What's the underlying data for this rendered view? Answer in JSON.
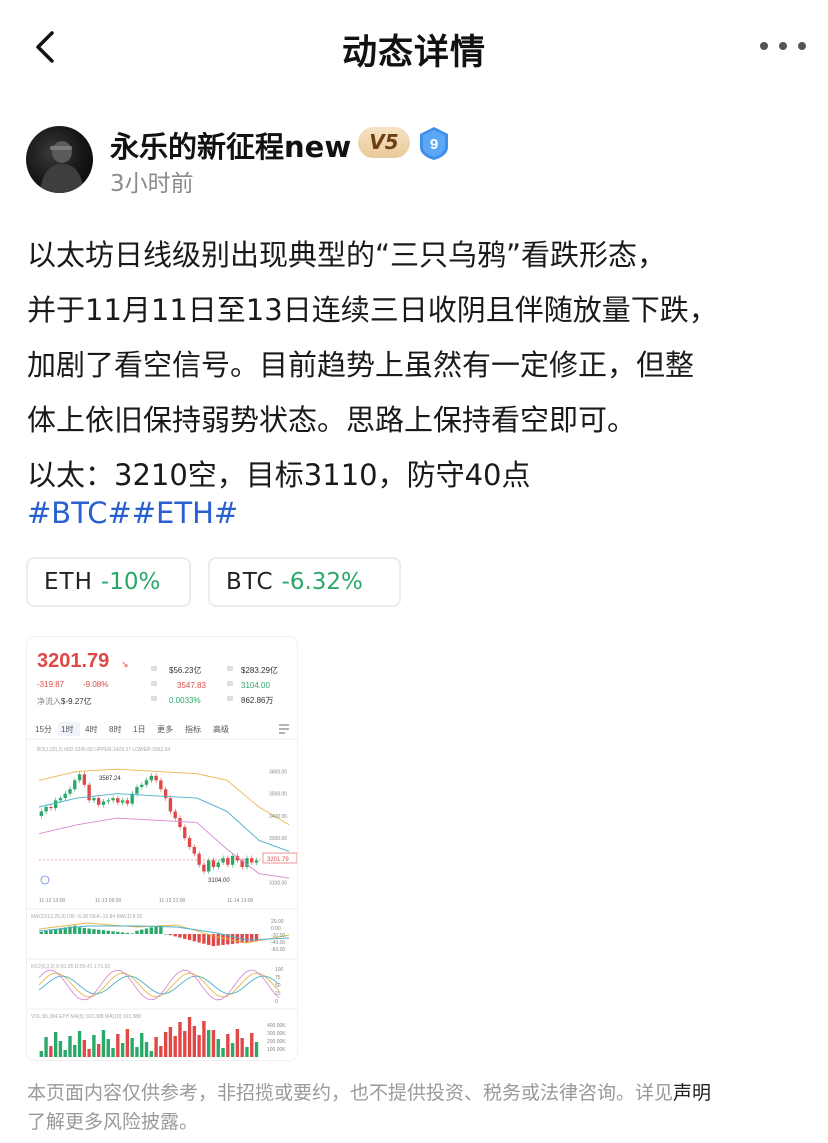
{
  "nav": {
    "title": "动态详情",
    "back_icon": "chevron-left-icon",
    "more_icon": "more-horizontal-icon"
  },
  "author": {
    "name": "永乐的新征程new",
    "vip_badge": "V5",
    "level": "9",
    "time": "3小时前"
  },
  "post": {
    "lines": [
      "以太坊日线级别出现典型的“三只乌鸦”看跌形态，",
      "并于11月11日至13日连续三日收阴且伴随放量下跌，",
      "加剧了看空信号。目前趋势上虽然有一定修正，但整",
      "体上依旧保持弱势状态。思路上保持看空即可。",
      "以太：3210空，目标3110，防守40点"
    ],
    "hashtags": "#BTC##ETH#"
  },
  "coin_tags": [
    {
      "symbol": "ETH",
      "change": "-10%"
    },
    {
      "symbol": "BTC",
      "change": "-6.32%"
    }
  ],
  "chart_image": {
    "price": "3201.79",
    "change": "-319.87",
    "change_pct": "-9.08%",
    "net_inflow_label": "净流入",
    "net_inflow": "$-9.27亿",
    "stats_left_values": [
      "$56.23亿",
      "3547.83",
      "0.0033%"
    ],
    "stats_right_values": [
      "$283.29亿",
      "3104.00",
      "862.86万"
    ],
    "tabs": [
      "15分",
      "1时",
      "4时",
      "8时",
      "1日",
      "更多",
      "指标",
      "高级"
    ],
    "active_tab": "1时",
    "high_label": "3587.24",
    "low_label": "3104.00",
    "y_ticks": [
      "3600.00",
      "3500.00",
      "3400.00",
      "3300.00",
      "3200.00",
      "3100.00"
    ],
    "current_price_tag": "3201.79",
    "x_ticks": [
      "11-12 13:00",
      "11-13 05:00",
      "11-13 21:00",
      "11-14 13:00"
    ],
    "macd_ticks": [
      "20.00",
      "0.00",
      "-20.00",
      "-40.00",
      "-60.00"
    ],
    "kdj_ticks": [
      "100",
      "75",
      "50",
      "25",
      "0"
    ],
    "vol_ticks": [
      "400.00K",
      "300.00K",
      "200.00K",
      "100.00K"
    ],
    "colors": {
      "up": "#2aa86a",
      "down": "#e04848",
      "mid": "#e8b84a",
      "upper": "#d98ad0",
      "lower": "#4ab0c8"
    }
  },
  "disclaimer": {
    "text": "本页面内容仅供参考，非招揽或要约，也不提供投资、税务或法律咨询。详见",
    "link": "声明",
    "tail": "了解更多风险披露。"
  }
}
